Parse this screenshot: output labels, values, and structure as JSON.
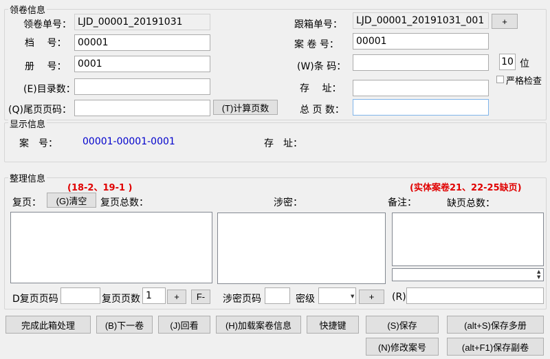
{
  "section1": {
    "title": "领卷信息",
    "juan_label": "领卷单号：",
    "juan_value": "LJD_00001_20191031",
    "gen_label": "跟箱单号：",
    "gen_value": "LJD_00001_20191031_001",
    "plus_btn": "+",
    "dang_label": "档　 号：",
    "dang_value": "00001",
    "anjuan_label": "案 卷 号：",
    "anjuan_value": "00001",
    "ce_label": "册　 号：",
    "ce_value": "0001",
    "tiaoma_label": "(W)条 码：",
    "tiaoma_value": "",
    "digits_value": "10",
    "digits_unit": "位",
    "strict_label": "严格检查",
    "mulu_label": "(E)目录数：",
    "mulu_value": "",
    "cunzhi_label": "存　 址：",
    "cunzhi_value": "",
    "weiye_label": "(Q)尾页页码：",
    "weiye_value": "",
    "calc_btn": "(T)计算页数",
    "zongye_label": "总 页 数：",
    "zongye_value": ""
  },
  "section2": {
    "title": "显示信息",
    "an_label": "案　号：",
    "an_value": "00001-00001-0001",
    "cz_label": "存　址："
  },
  "section3": {
    "title": "整理信息",
    "note_left": "(18-2、19-1 )",
    "note_right": "(实体案卷21、22-25缺页)",
    "fuye_label": "复页：",
    "clear_btn": "(G)清空",
    "fuye_total_label": "复页总数：",
    "shemi_label": "涉密：",
    "beizhu_label": "备注：",
    "queye_label": "缺页总数：",
    "d_label": "D复页页码",
    "d_value": "",
    "fuye_count_label": "复页页数",
    "fuye_count_value": "1",
    "plus": "+",
    "minus": "F-",
    "shemi_page_label": "涉密页码",
    "shemi_page_value": "",
    "miji_label": "密级",
    "miji_value": "",
    "plus2": "+",
    "r_label": "(R)",
    "r_value": ""
  },
  "buttons": {
    "finish": "完成此箱处理",
    "next": "(B)下一卷",
    "review": "(J)回看",
    "load": "(H)加载案卷信息",
    "shortcut": "快捷键",
    "save": "(S)保存",
    "save_multi": "(alt+S)保存多册",
    "modify": "(N)修改案号",
    "save_copy": "(alt+F1)保存副卷"
  }
}
